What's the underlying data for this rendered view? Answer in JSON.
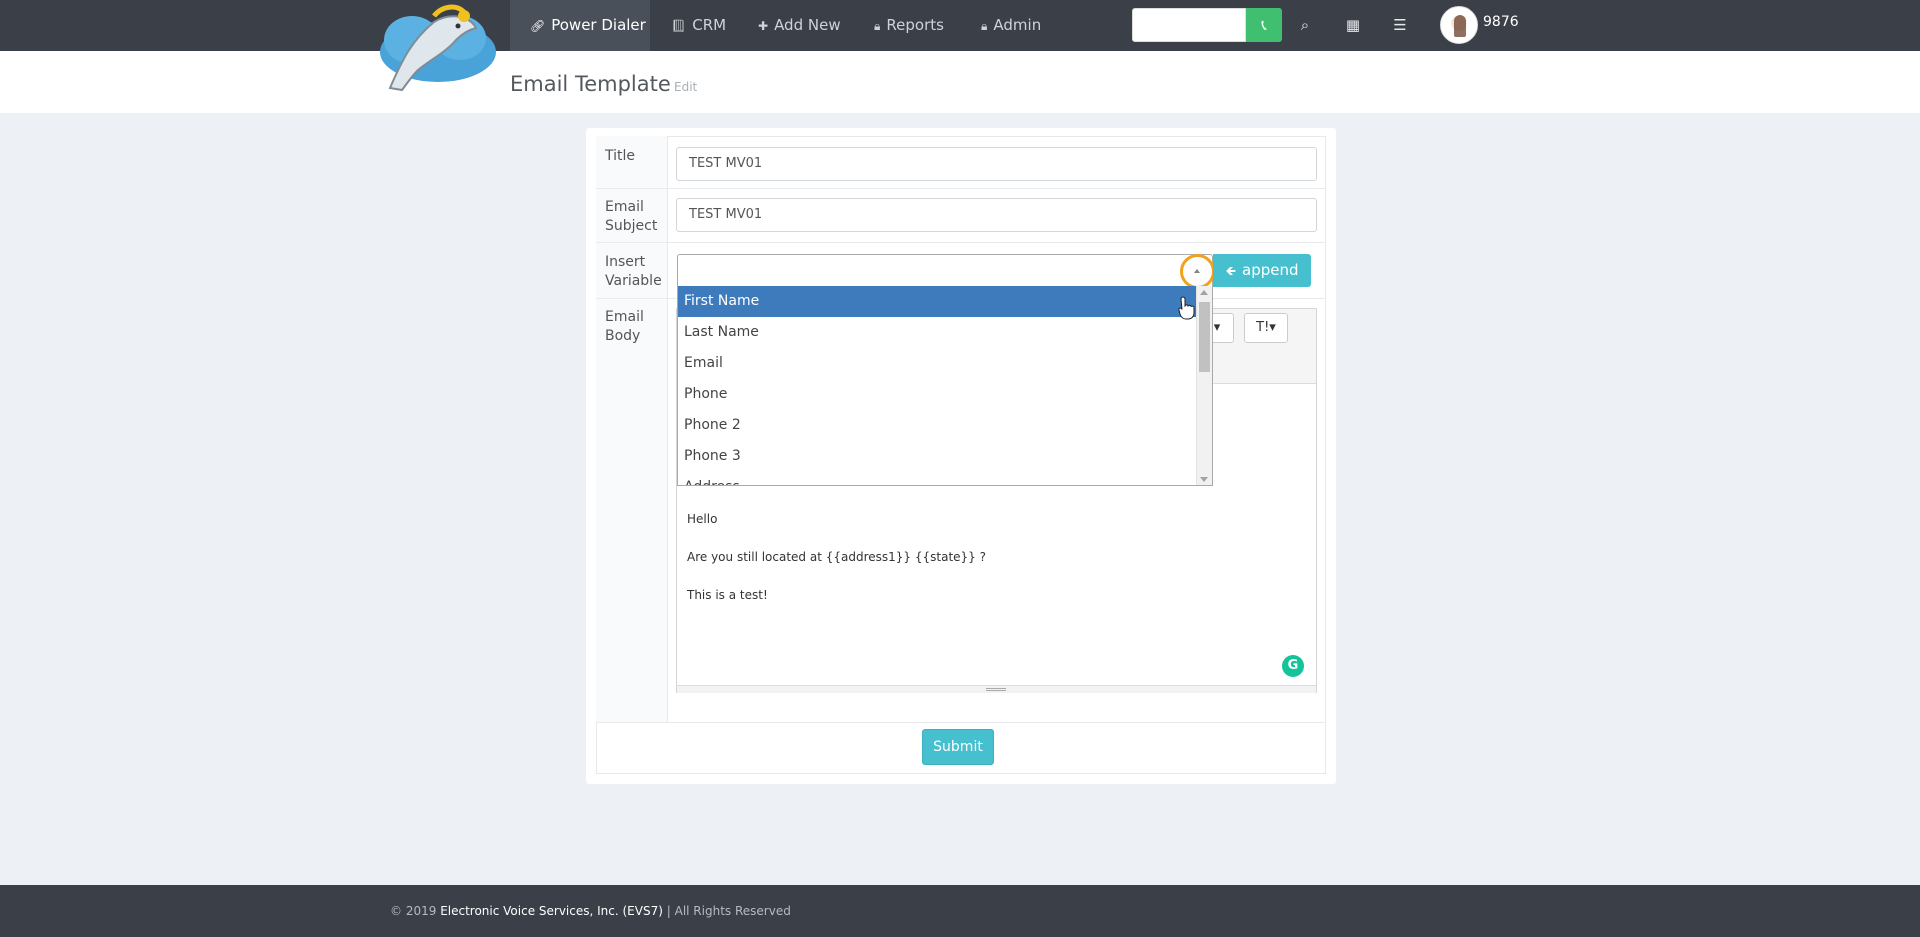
{
  "nav": {
    "items": [
      {
        "label": "Power Dialer",
        "icon": "link-icon",
        "glyph": "🔗︎"
      },
      {
        "label": "CRM",
        "icon": "book-icon",
        "glyph": "📕︎"
      },
      {
        "label": "Add New",
        "icon": "plus-icon",
        "glyph": "✚"
      },
      {
        "label": "Reports",
        "icon": "lock-icon",
        "glyph": "🔒︎"
      },
      {
        "label": "Admin",
        "icon": "lock-icon",
        "glyph": "🔒︎"
      }
    ],
    "call_glyph": "📞︎",
    "search_glyph": "⌕",
    "calendar_glyph": "▦",
    "list_glyph": "☰",
    "user_id": "9876"
  },
  "page": {
    "title": "Email Template",
    "subtitle": "Edit"
  },
  "form": {
    "title_label": "Title",
    "title_value": "TEST MV01",
    "subject_label_1": "Email",
    "subject_label_2": "Subject",
    "subject_value": "TEST MV01",
    "variable_label_1": "Insert",
    "variable_label_2": "Variable",
    "body_label_1": "Email",
    "body_label_2": "Body",
    "append_label": "append",
    "append_glyph": "🡸",
    "submit_label": "Submit"
  },
  "dropdown": {
    "options": [
      "First Name",
      "Last Name",
      "Email",
      "Phone",
      "Phone 2",
      "Phone 3",
      "Address"
    ],
    "highlighted": "First Name"
  },
  "editor": {
    "toolbar_font_label": "T!▾",
    "lines": [
      "Hello",
      "Are you still located at {{address1}} {{state}} ?",
      "This is a test!"
    ]
  },
  "footer": {
    "prefix": "© 2019",
    "company": "Electronic Voice Services, Inc. (EVS7)",
    "suffix": "| All Rights Reserved"
  },
  "colors": {
    "topbar": "#3a3f48",
    "accent": "#46c0cf",
    "call_green": "#3fbf6f",
    "highlight_blue": "#3d7bbd"
  }
}
